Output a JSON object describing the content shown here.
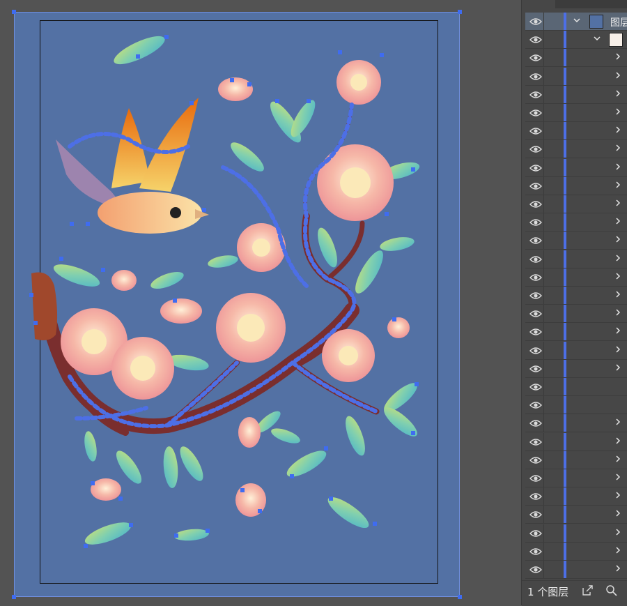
{
  "panel": {
    "top_layer_name": "图层",
    "footer_count": "1 个图层",
    "rows": [
      {
        "type": "layer",
        "selected": true,
        "expanded": true,
        "name": "图层"
      },
      {
        "type": "group",
        "expanded": true
      },
      {
        "type": "item",
        "chevron": true
      },
      {
        "type": "item",
        "chevron": true
      },
      {
        "type": "item",
        "chevron": true
      },
      {
        "type": "item",
        "chevron": true
      },
      {
        "type": "item",
        "chevron": true
      },
      {
        "type": "item",
        "chevron": true
      },
      {
        "type": "item",
        "chevron": true
      },
      {
        "type": "item",
        "chevron": true
      },
      {
        "type": "item",
        "chevron": true
      },
      {
        "type": "item",
        "chevron": true
      },
      {
        "type": "item",
        "chevron": true
      },
      {
        "type": "item",
        "chevron": true
      },
      {
        "type": "item",
        "chevron": true
      },
      {
        "type": "item",
        "chevron": true
      },
      {
        "type": "item",
        "chevron": true
      },
      {
        "type": "item",
        "chevron": true
      },
      {
        "type": "item",
        "chevron": true
      },
      {
        "type": "item",
        "chevron": true
      },
      {
        "type": "item",
        "chevron": false
      },
      {
        "type": "item",
        "chevron": false
      },
      {
        "type": "item",
        "chevron": true
      },
      {
        "type": "item",
        "chevron": true
      },
      {
        "type": "item",
        "chevron": true
      },
      {
        "type": "item",
        "chevron": true
      },
      {
        "type": "item",
        "chevron": true
      },
      {
        "type": "item",
        "chevron": true
      },
      {
        "type": "item",
        "chevron": true
      },
      {
        "type": "item",
        "chevron": true
      },
      {
        "type": "item",
        "chevron": true
      }
    ],
    "icons": {
      "eye": "eye-icon",
      "chevron": "chevron-right-icon",
      "expand": "chevron-down-icon",
      "export": "export-icon",
      "search": "search-icon"
    }
  },
  "colors": {
    "canvas": "#5371a4",
    "selection": "#4d6fe6",
    "petal": "#f2a0a0",
    "leaf": "#a9d66d",
    "branch": "#7a2e2e",
    "bird_wing": "#f08a1a"
  }
}
